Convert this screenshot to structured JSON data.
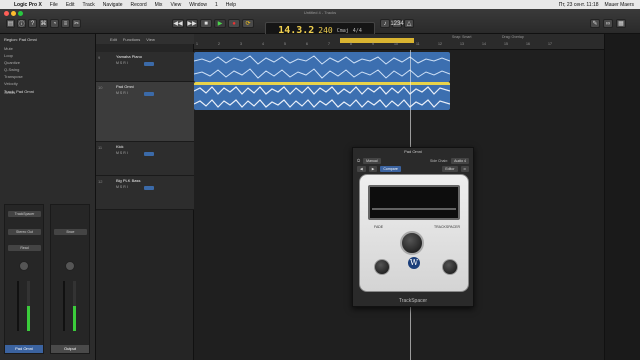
{
  "menubar": {
    "apple": "",
    "app": "Logic Pro X",
    "items": [
      "File",
      "Edit",
      "Track",
      "Navigate",
      "Record",
      "Mix",
      "View",
      "Window",
      "1",
      "Help"
    ],
    "clock": "Пт, 23 сент. 11:18",
    "user": "Mauer Maers"
  },
  "window": {
    "title": "Untitled 4 - Tracks"
  },
  "lcd": {
    "bar": "14.3.2",
    "tempo": "240",
    "key": "Cmaj",
    "sig": "4/4"
  },
  "inspector": {
    "region_label": "Region: Pad Omni",
    "track_label": "Track: Pad Omni",
    "rows": [
      "Mute",
      "Loop",
      "Quantize",
      "Q-Swing",
      "Transpose",
      "Velocity",
      "Sends"
    ],
    "strip1": {
      "plugin": "TrackSpacer",
      "input": "Stereo Out",
      "group": "Read",
      "name": "Pad Omni"
    },
    "strip2": {
      "plugin": "Bnce",
      "name": "Output"
    }
  },
  "tracklist": {
    "header": [
      "Edit",
      "Functions",
      "View"
    ],
    "tracks": [
      {
        "num": "9",
        "name": "Yamaha Piano",
        "btns": "M S R I"
      },
      {
        "num": "10",
        "name": "Pad Omni",
        "btns": "M S R I"
      },
      {
        "num": "11",
        "name": "Kick",
        "btns": "M S R I"
      },
      {
        "num": "12",
        "name": "Big PLK Bass",
        "btns": "M S R I"
      }
    ]
  },
  "ruler": {
    "marks": [
      "1",
      "2",
      "3",
      "4",
      "5",
      "6",
      "7",
      "8",
      "9",
      "10",
      "11",
      "12",
      "13",
      "14",
      "15",
      "16",
      "17"
    ],
    "snap": "Snap: Smart",
    "drag": "Drag: Overlap"
  },
  "plugin": {
    "title": "Pad Omni",
    "preset": "Manual",
    "sidechain_label": "Side Chain:",
    "sidechain_value": "Audio 4",
    "compare": "Compare",
    "editor": "Editor",
    "fade_label": "FADE",
    "trackspacer_label": "TRACKSPACER",
    "foot": "TrackSpacer",
    "logo": "W"
  }
}
